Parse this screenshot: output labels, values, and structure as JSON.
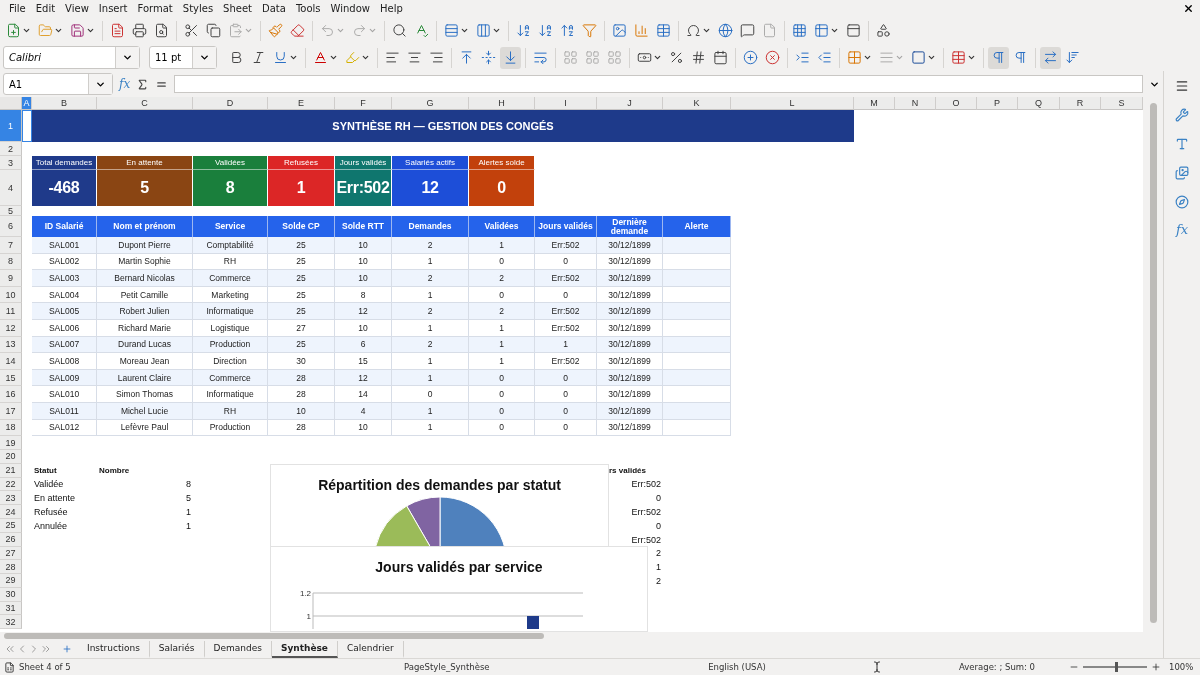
{
  "menu": [
    "File",
    "Edit",
    "View",
    "Insert",
    "Format",
    "Styles",
    "Sheet",
    "Data",
    "Tools",
    "Window",
    "Help"
  ],
  "font_box": {
    "font": "Calibri",
    "size": "11 pt"
  },
  "formula_bar": {
    "name_box": "A1",
    "function_wizard": "fx"
  },
  "columns": [
    {
      "label": "A",
      "selected": true
    },
    {
      "label": "B",
      "selected": false
    },
    {
      "label": "C",
      "selected": false
    },
    {
      "label": "D",
      "selected": false
    },
    {
      "label": "E",
      "selected": false
    },
    {
      "label": "F",
      "selected": false
    },
    {
      "label": "G",
      "selected": false
    },
    {
      "label": "H",
      "selected": false
    },
    {
      "label": "I",
      "selected": false
    },
    {
      "label": "J",
      "selected": false
    },
    {
      "label": "K",
      "selected": false
    },
    {
      "label": "L",
      "selected": false
    },
    {
      "label": "M",
      "selected": false
    },
    {
      "label": "N",
      "selected": false
    },
    {
      "label": "O",
      "selected": false
    },
    {
      "label": "P",
      "selected": false
    },
    {
      "label": "Q",
      "selected": false
    },
    {
      "label": "R",
      "selected": false
    },
    {
      "label": "S",
      "selected": false
    }
  ],
  "rows": [
    {
      "label": "1",
      "selected": true
    },
    {
      "label": "2",
      "selected": false
    },
    {
      "label": "3",
      "selected": false
    },
    {
      "label": "4",
      "selected": false
    },
    {
      "label": "5",
      "selected": false
    },
    {
      "label": "6",
      "selected": false
    },
    {
      "label": "7",
      "selected": false
    },
    {
      "label": "8",
      "selected": false
    },
    {
      "label": "9",
      "selected": false
    },
    {
      "label": "10",
      "selected": false
    },
    {
      "label": "11",
      "selected": false
    },
    {
      "label": "12",
      "selected": false
    },
    {
      "label": "13",
      "selected": false
    },
    {
      "label": "14",
      "selected": false
    },
    {
      "label": "15",
      "selected": false
    },
    {
      "label": "16",
      "selected": false
    },
    {
      "label": "17",
      "selected": false
    },
    {
      "label": "18",
      "selected": false
    },
    {
      "label": "19",
      "selected": false
    },
    {
      "label": "20",
      "selected": false
    },
    {
      "label": "21",
      "selected": false
    },
    {
      "label": "22",
      "selected": false
    },
    {
      "label": "23",
      "selected": false
    },
    {
      "label": "24",
      "selected": false
    },
    {
      "label": "25",
      "selected": false
    },
    {
      "label": "26",
      "selected": false
    },
    {
      "label": "27",
      "selected": false
    },
    {
      "label": "28",
      "selected": false
    },
    {
      "label": "29",
      "selected": false
    },
    {
      "label": "30",
      "selected": false
    },
    {
      "label": "31",
      "selected": false
    },
    {
      "label": "32",
      "selected": false
    }
  ],
  "title": "SYNTHÈSE RH — GESTION DES CONGÉS",
  "kpis": [
    {
      "label": "Total demandes",
      "value": "-468",
      "color": "#1f3a8a"
    },
    {
      "label": "En attente",
      "value": "5",
      "color": "#8a4513"
    },
    {
      "label": "Validées",
      "value": "8",
      "color": "#1a7f3c"
    },
    {
      "label": "Refusées",
      "value": "1",
      "color": "#dc2626"
    },
    {
      "label": "Jours validés",
      "value": "Err:502",
      "color": "#0f766e"
    },
    {
      "label": "Salariés actifs",
      "value": "12",
      "color": "#1d4ed8"
    },
    {
      "label": "Alertes solde",
      "value": "0",
      "color": "#c2410c"
    }
  ],
  "table": {
    "columns": [
      "ID Salarié",
      "Nom et prénom",
      "Service",
      "Solde CP",
      "Solde RTT",
      "Demandes",
      "Validées",
      "Jours validés",
      "Dernière demande",
      "Alerte"
    ],
    "rows": [
      [
        "SAL001",
        "Dupont Pierre",
        "Comptabilité",
        "25",
        "10",
        "2",
        "1",
        "Err:502",
        "30/12/1899"
      ],
      [
        "SAL002",
        "Martin Sophie",
        "RH",
        "25",
        "10",
        "1",
        "0",
        "0",
        "30/12/1899"
      ],
      [
        "SAL003",
        "Bernard Nicolas",
        "Commerce",
        "25",
        "10",
        "2",
        "2",
        "Err:502",
        "30/12/1899"
      ],
      [
        "SAL004",
        "Petit Camille",
        "Marketing",
        "25",
        "8",
        "1",
        "0",
        "0",
        "30/12/1899"
      ],
      [
        "SAL005",
        "Robert Julien",
        "Informatique",
        "25",
        "12",
        "2",
        "2",
        "Err:502",
        "30/12/1899"
      ],
      [
        "SAL006",
        "Richard Marie",
        "Logistique",
        "27",
        "10",
        "1",
        "1",
        "Err:502",
        "30/12/1899"
      ],
      [
        "SAL007",
        "Durand Lucas",
        "Production",
        "25",
        "6",
        "2",
        "1",
        "1",
        "30/12/1899"
      ],
      [
        "SAL008",
        "Moreau Jean",
        "Direction",
        "30",
        "15",
        "1",
        "1",
        "Err:502",
        "30/12/1899"
      ],
      [
        "SAL009",
        "Laurent Claire",
        "Commerce",
        "28",
        "12",
        "1",
        "0",
        "0",
        "30/12/1899"
      ],
      [
        "SAL010",
        "Simon Thomas",
        "Informatique",
        "28",
        "14",
        "0",
        "0",
        "0",
        "30/12/1899"
      ],
      [
        "SAL011",
        "Michel Lucie",
        "RH",
        "10",
        "4",
        "1",
        "0",
        "0",
        "30/12/1899"
      ],
      [
        "SAL012",
        "Lefèvre Paul",
        "Production",
        "28",
        "10",
        "1",
        "0",
        "0",
        "30/12/1899"
      ]
    ]
  },
  "status_summary": {
    "columns": [
      "Statut",
      "Nombre"
    ],
    "rows": [
      [
        "Validée",
        "8"
      ],
      [
        "En attente",
        "5"
      ],
      [
        "Refusée",
        "1"
      ],
      [
        "Annulée",
        "1"
      ]
    ]
  },
  "side_column": {
    "header": "rs validés",
    "values": [
      "Err:502",
      "0",
      "Err:502",
      "0",
      "Err:502",
      "2",
      "1",
      "2"
    ]
  },
  "pie_chart": {
    "title": "Répartition des demandes par statut"
  },
  "bar_chart": {
    "title": "Jours validés par service",
    "axis_labels": [
      "1.2",
      "1"
    ]
  },
  "sheet_tabs": [
    {
      "label": "Instructions",
      "selected": false
    },
    {
      "label": "Salariés",
      "selected": false
    },
    {
      "label": "Demandes",
      "selected": false
    },
    {
      "label": "Synthèse",
      "selected": true
    },
    {
      "label": "Calendrier",
      "selected": false
    }
  ],
  "status_bar": {
    "sheet": "Sheet 4 of 5",
    "page_style": "PageStyle_Synthèse",
    "language": "English (USA)",
    "summary": "Average: ; Sum: 0",
    "zoom": {
      "level": 0.5,
      "reading": "100%"
    }
  },
  "sidebar": {
    "function_label": "fx"
  }
}
